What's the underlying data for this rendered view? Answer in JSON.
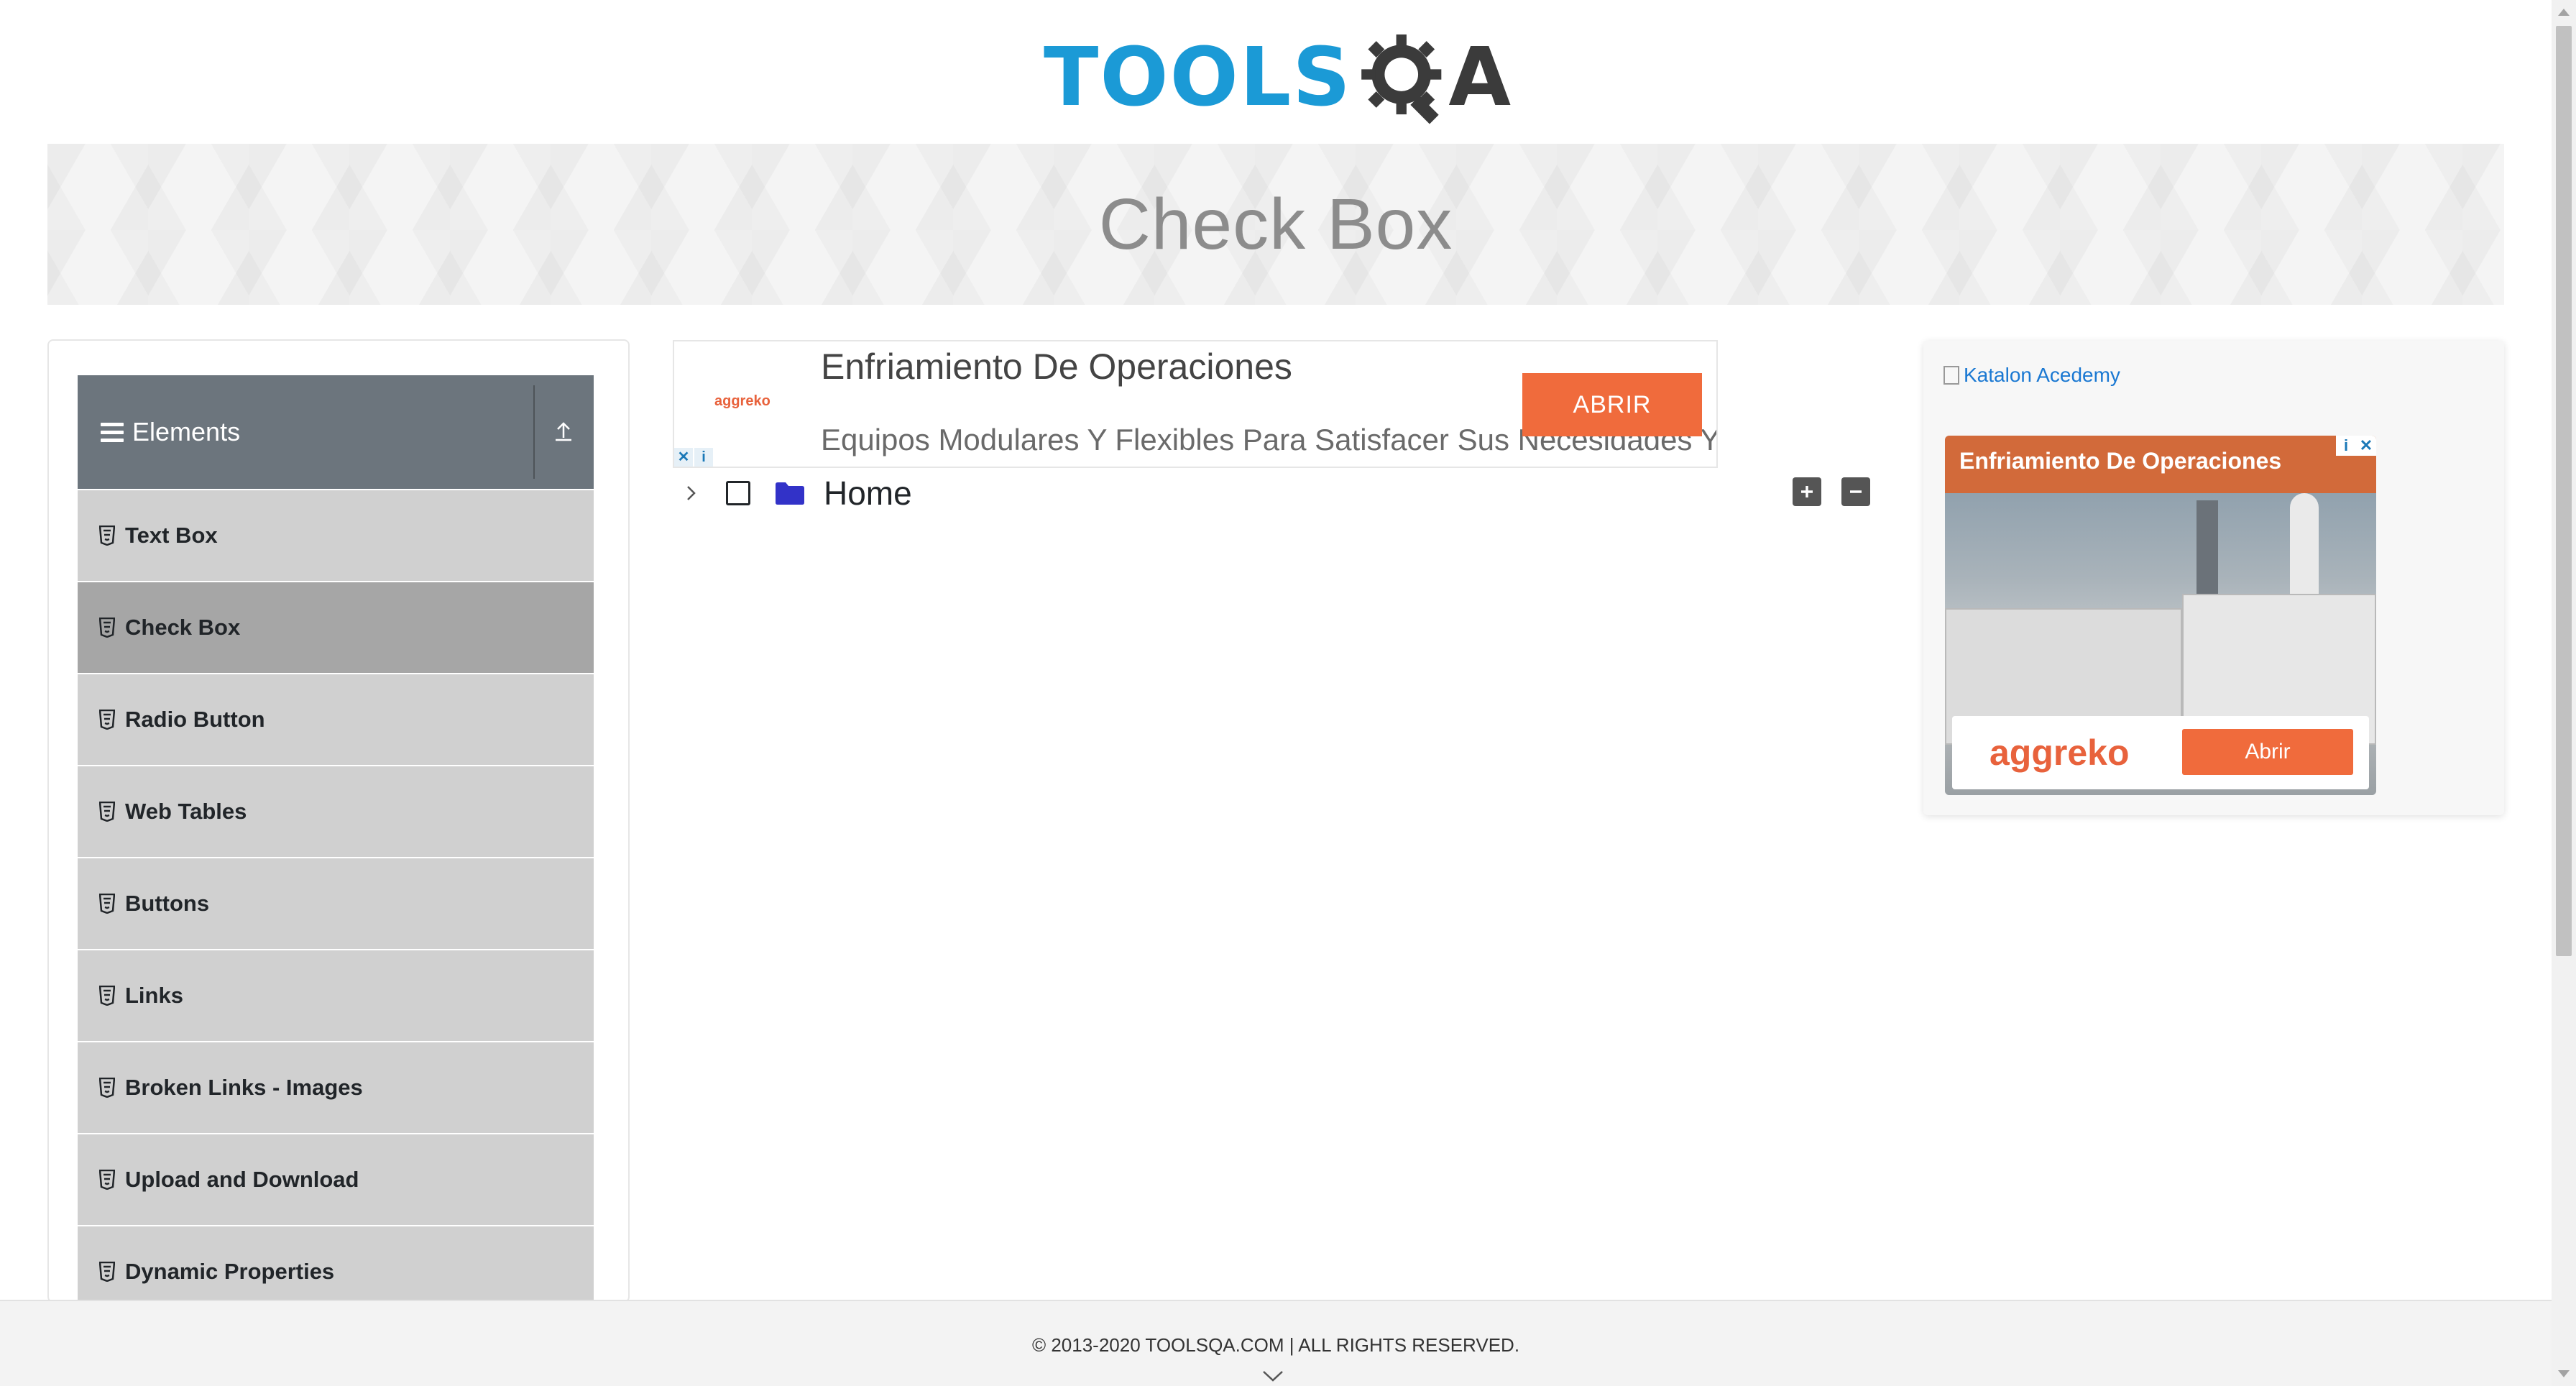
{
  "logo": {
    "text_blue": "TOOLS",
    "text_dark": "A",
    "alt": "ToolsQA"
  },
  "banner": {
    "title": "Check Box"
  },
  "sidebar": {
    "group_title": "Elements",
    "items": [
      {
        "label": "Text Box"
      },
      {
        "label": "Check Box",
        "active": true
      },
      {
        "label": "Radio Button"
      },
      {
        "label": "Web Tables"
      },
      {
        "label": "Buttons"
      },
      {
        "label": "Links"
      },
      {
        "label": "Broken Links - Images"
      },
      {
        "label": "Upload and Download"
      },
      {
        "label": "Dynamic Properties"
      }
    ]
  },
  "top_ad": {
    "brand": "aggreko",
    "headline": "Enfriamiento De Operaciones",
    "description": "Equipos Modulares Y Flexibles Para Satisfacer Sus Necesidades Y Cumplir Sus Objetivos",
    "cta": "ABRIR"
  },
  "tree": {
    "root_label": "Home",
    "expand_all_icon": "plus-icon",
    "collapse_all_icon": "minus-icon"
  },
  "right_ad": {
    "image_alt": "Katalon Acedemy",
    "card_title": "Enfriamiento De Operaciones",
    "brand": "aggreko",
    "cta": "Abrir"
  },
  "footer": {
    "copyright": "© 2013-2020 TOOLSQA.COM | ALL RIGHTS RESERVED."
  },
  "colors": {
    "accent_blue": "#1b9ad6",
    "sidebar_header": "#6c757d",
    "sidebar_item": "#d0d0d0",
    "sidebar_active": "#a6a6a6",
    "ad_orange": "#f06b3c"
  }
}
